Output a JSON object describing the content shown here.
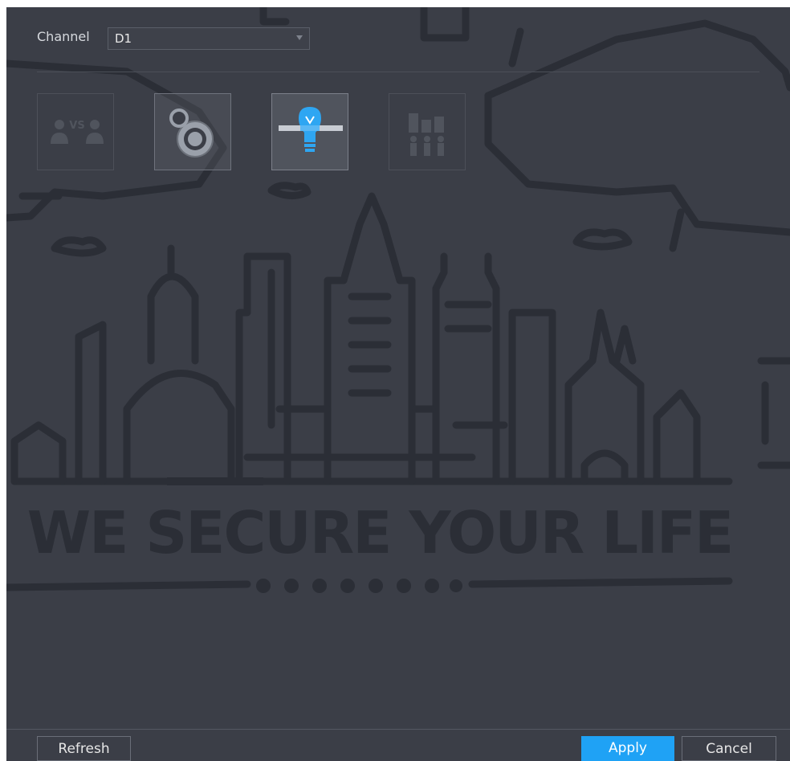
{
  "channel": {
    "label": "Channel",
    "value": "D1"
  },
  "tiles": [
    {
      "icon": "face-compare-icon",
      "text": "VS",
      "state": "disabled"
    },
    {
      "icon": "settings-dial-icon",
      "state": "normal"
    },
    {
      "icon": "tripwire-bulb-icon",
      "state": "selected"
    },
    {
      "icon": "people-counting-icon",
      "state": "disabled"
    }
  ],
  "wallpaper": {
    "slogan": "WE SECURE YOUR LIFE"
  },
  "buttons": {
    "refresh": "Refresh",
    "apply": "Apply",
    "cancel": "Cancel"
  },
  "colors": {
    "panel_bg": "#3b3e47",
    "accent": "#1fa2f5",
    "wallpaper_ink": "#2b2e36"
  }
}
